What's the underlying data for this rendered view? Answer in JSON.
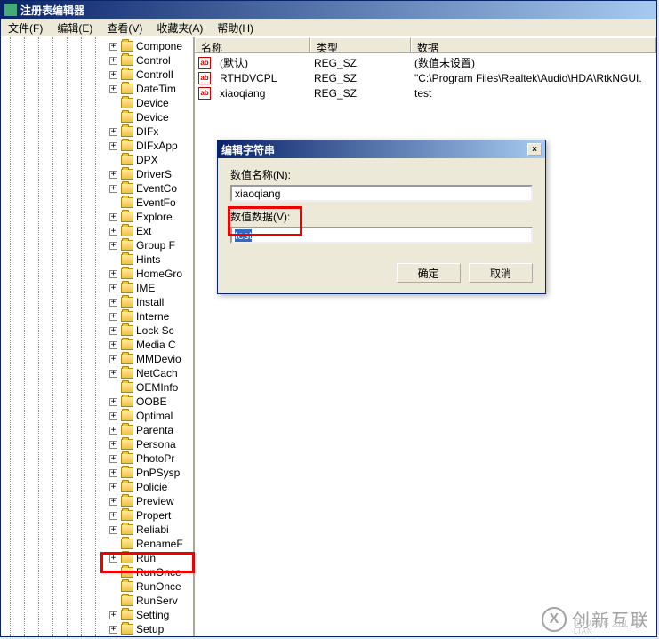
{
  "window": {
    "title": "注册表编辑器"
  },
  "menu": {
    "file": "文件(F)",
    "edit": "编辑(E)",
    "view": "查看(V)",
    "favorites": "收藏夹(A)",
    "help": "帮助(H)"
  },
  "tree": {
    "items": [
      {
        "label": "Compone",
        "expand": "+"
      },
      {
        "label": "Control",
        "expand": "+"
      },
      {
        "label": "ControlI",
        "expand": "+"
      },
      {
        "label": "DateTim",
        "expand": "+"
      },
      {
        "label": "Device",
        "expand": ""
      },
      {
        "label": "Device",
        "expand": ""
      },
      {
        "label": "DIFx",
        "expand": "+"
      },
      {
        "label": "DIFxApp",
        "expand": "+"
      },
      {
        "label": "DPX",
        "expand": ""
      },
      {
        "label": "DriverS",
        "expand": "+"
      },
      {
        "label": "EventCo",
        "expand": "+"
      },
      {
        "label": "EventFo",
        "expand": ""
      },
      {
        "label": "Explore",
        "expand": "+"
      },
      {
        "label": "Ext",
        "expand": "+"
      },
      {
        "label": "Group F",
        "expand": "+"
      },
      {
        "label": "Hints",
        "expand": ""
      },
      {
        "label": "HomeGro",
        "expand": "+"
      },
      {
        "label": "IME",
        "expand": "+"
      },
      {
        "label": "Install",
        "expand": "+"
      },
      {
        "label": "Interne",
        "expand": "+"
      },
      {
        "label": "Lock Sc",
        "expand": "+"
      },
      {
        "label": "Media C",
        "expand": "+"
      },
      {
        "label": "MMDevio",
        "expand": "+"
      },
      {
        "label": "NetCach",
        "expand": "+"
      },
      {
        "label": "OEMInfo",
        "expand": ""
      },
      {
        "label": "OOBE",
        "expand": "+"
      },
      {
        "label": "Optimal",
        "expand": "+"
      },
      {
        "label": "Parenta",
        "expand": "+"
      },
      {
        "label": "Persona",
        "expand": "+"
      },
      {
        "label": "PhotoPr",
        "expand": "+"
      },
      {
        "label": "PnPSysp",
        "expand": "+"
      },
      {
        "label": "Policie",
        "expand": "+"
      },
      {
        "label": "Preview",
        "expand": "+"
      },
      {
        "label": "Propert",
        "expand": "+"
      },
      {
        "label": "Reliabi",
        "expand": "+"
      },
      {
        "label": "RenameF",
        "expand": ""
      },
      {
        "label": "Run",
        "expand": "+"
      },
      {
        "label": "RunOnce",
        "expand": ""
      },
      {
        "label": "RunOnce",
        "expand": ""
      },
      {
        "label": "RunServ",
        "expand": ""
      },
      {
        "label": "Setting",
        "expand": "+"
      },
      {
        "label": "Setup",
        "expand": "+"
      }
    ]
  },
  "list": {
    "headers": {
      "name": "名称",
      "type": "类型",
      "data": "数据"
    },
    "rows": [
      {
        "name": "(默认)",
        "type": "REG_SZ",
        "data": "(数值未设置)"
      },
      {
        "name": "RTHDVCPL",
        "type": "REG_SZ",
        "data": "\"C:\\Program Files\\Realtek\\Audio\\HDA\\RtkNGUI."
      },
      {
        "name": "xiaoqiang",
        "type": "REG_SZ",
        "data": "test"
      }
    ],
    "icon_label": "ab"
  },
  "dialog": {
    "title": "编辑字符串",
    "name_label": "数值名称(N):",
    "name_value": "xiaoqiang",
    "data_label": "数值数据(V):",
    "data_value": "test",
    "ok": "确定",
    "cancel": "取消",
    "close": "×"
  },
  "watermark": {
    "icon": "X",
    "text": "创新互联",
    "sub": "CHUANG XIN HU LIAN"
  }
}
